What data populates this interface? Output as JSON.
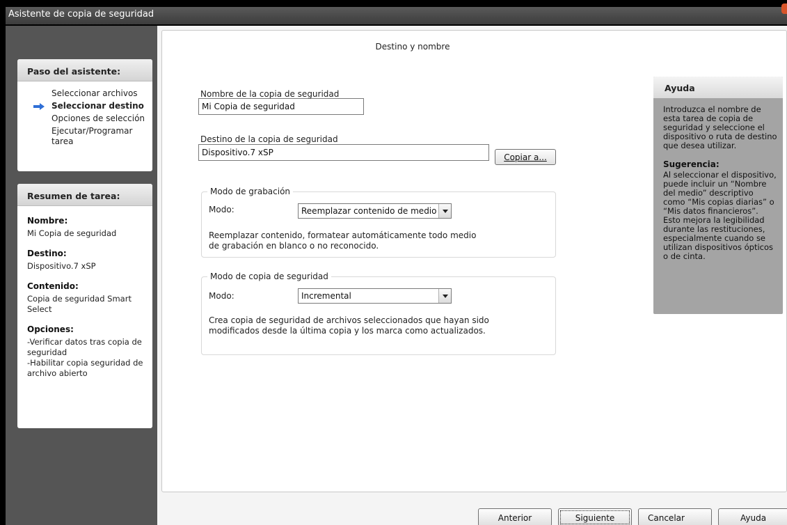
{
  "window": {
    "title": "Asistente de copia de seguridad"
  },
  "steps_panel": {
    "header": "Paso del asistente:",
    "steps": [
      {
        "label": "Seleccionar archivos"
      },
      {
        "label": "Seleccionar destino"
      },
      {
        "label": "Opciones de selección"
      },
      {
        "label": "Ejecutar/Programar tarea"
      }
    ],
    "active_icon": "right-arrow-icon"
  },
  "summary_panel": {
    "header": "Resumen de tarea:",
    "name_label": "Nombre:",
    "name_value": "Mi Copia de seguridad",
    "dest_label": "Destino:",
    "dest_value": "Dispositivo.7 xSP",
    "content_label": "Contenido:",
    "content_value": "Copia de seguridad Smart Select",
    "options_label": "Opciones:",
    "options_line1": "-Verificar datos tras copia de seguridad",
    "options_line2": "-Habilitar copia seguridad de archivo abierto"
  },
  "main": {
    "title": "Destino y nombre",
    "name_field_label": "Nombre de la copia de seguridad",
    "name_field_value": "Mi Copia de seguridad",
    "dest_field_label": "Destino de la copia de seguridad",
    "dest_field_value": "Dispositivo.7 xSP",
    "copy_to_button": "Copiar a...",
    "write_mode": {
      "title": "Modo de grabación",
      "mode_label": "Modo:",
      "mode_value": "Reemplazar contenido de medio d",
      "description": "Reemplazar contenido, formatear automáticamente todo medio de grabación en blanco o no reconocido."
    },
    "backup_mode": {
      "title": "Modo de copia de seguridad",
      "mode_label": "Modo:",
      "mode_value": "Incremental",
      "description": "Crea copia de seguridad de archivos seleccionados que hayan sido modificados desde la última copia y los marca como actualizados."
    }
  },
  "help": {
    "header": "Ayuda",
    "text": "Introduzca el nombre de esta tarea de copia de seguridad y seleccione el dispositivo o ruta de destino que desea utilizar.",
    "tip_title": "Sugerencia:",
    "tip_text": "Al seleccionar el dispositivo, puede incluir un “Nombre del medio” descriptivo como “Mis copias diarias” o “Mis datos financieros”. Esto mejora la legibilidad durante las restituciones, especialmente cuando se utilizan dispositivos ópticos o de cinta."
  },
  "footer": {
    "back": "Anterior",
    "next": "Siguiente",
    "cancel": "Cancelar",
    "help": "Ayuda"
  },
  "colors": {
    "sidebar": "#555555",
    "help_panel": "#a4a4a4",
    "arrow": "#2f6fd6"
  }
}
